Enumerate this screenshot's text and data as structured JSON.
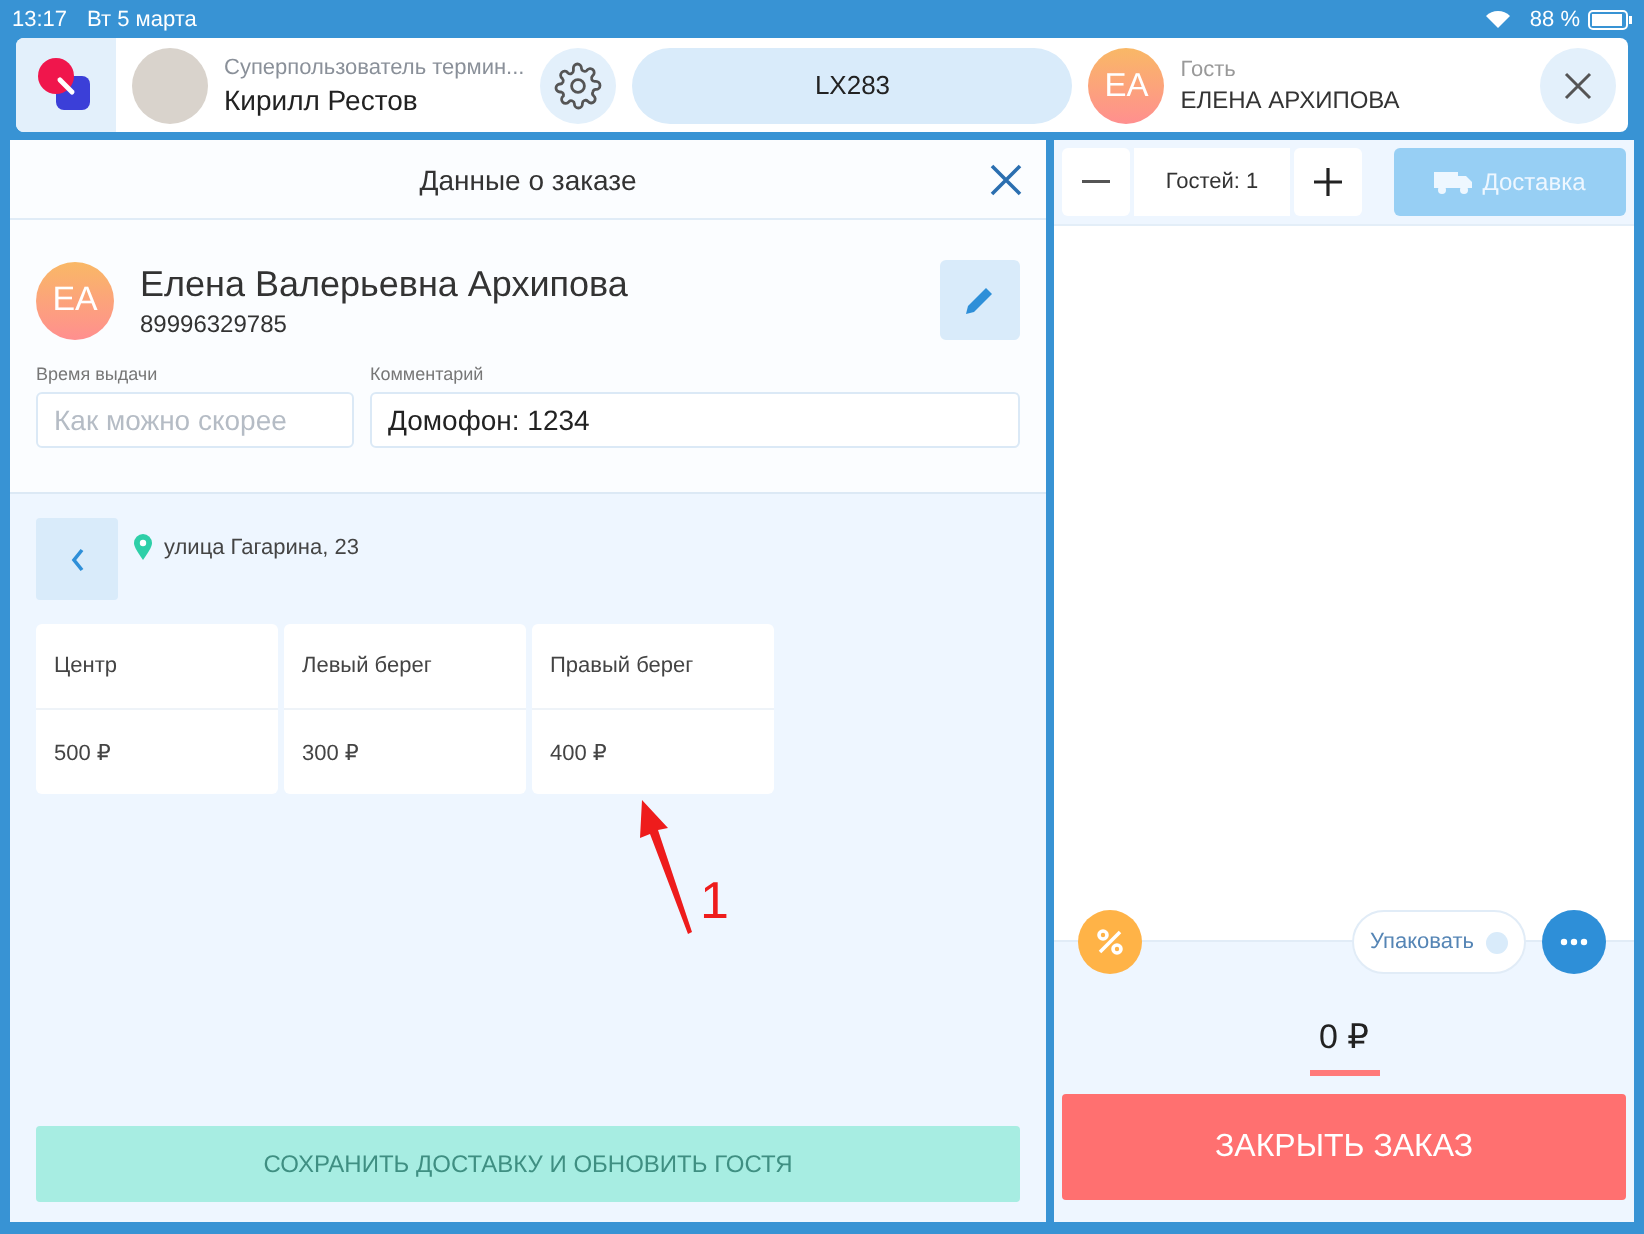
{
  "status_bar": {
    "time": "13:17",
    "date": "Вт 5 марта",
    "battery": "88 %"
  },
  "header": {
    "user_role": "Суперпользователь термин...",
    "user_name": "Кирилл Рестов",
    "order_code": "LX283",
    "guest_initials": "EA",
    "guest_label": "Гость",
    "guest_name": "ЕЛЕНА АРХИПОВА"
  },
  "order_panel": {
    "title": "Данные о заказе",
    "customer_initials": "EA",
    "customer_name": "Елена Валерьевна Архипова",
    "customer_phone": "89996329785",
    "fields": [
      {
        "label": "Время выдачи",
        "placeholder": "Как можно скорее"
      },
      {
        "label": "Комментарий",
        "value": "Домофон: 1234"
      }
    ],
    "address": "улица Гагарина, 23",
    "zones": [
      {
        "name": "Центр",
        "price": "500 ₽"
      },
      {
        "name": "Левый берег",
        "price": "300 ₽"
      },
      {
        "name": "Правый берег",
        "price": "400 ₽"
      }
    ],
    "save_button": {
      "label": "СОХРАНИТЬ ДОСТАВКУ И ОБНОВИТЬ ГОСТЯ",
      "disabled": true
    }
  },
  "annotation": {
    "label": "1"
  },
  "cart": {
    "guests": "Гостей: 1",
    "delivery_button": {
      "label": "Доставка",
      "disabled": true
    },
    "pack": {
      "label": "Упаковать",
      "on": false
    },
    "total": "0 ₽",
    "close_button": "ЗАКРЫТЬ ЗАКАЗ"
  }
}
